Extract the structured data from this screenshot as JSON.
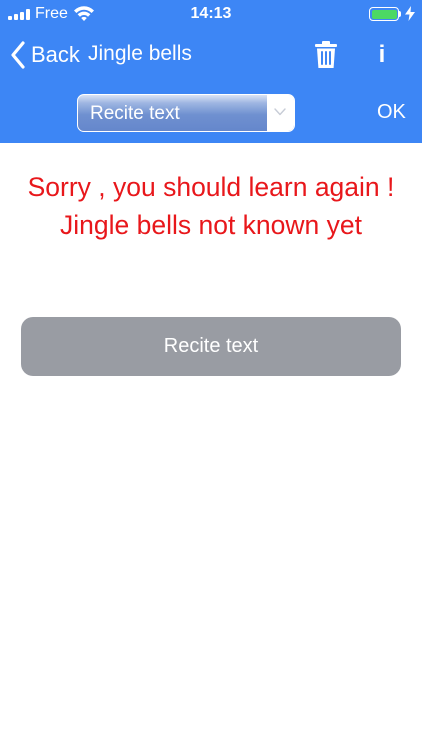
{
  "status_bar": {
    "carrier": "Free",
    "time": "14:13"
  },
  "nav": {
    "back_label": "Back",
    "title": "Jingle bells",
    "info_label": "i"
  },
  "toolbar": {
    "mode_select": {
      "selected": "Recite text"
    },
    "ok_label": "OK"
  },
  "main": {
    "message": "Sorry , you should learn again ! Jingle bells not known yet",
    "recite_button_label": "Recite text"
  },
  "colors": {
    "header_background": "#3d86f5",
    "message_text": "#e8171b",
    "button_background": "#999ca3",
    "battery_fill": "#4cd964"
  },
  "icons": {
    "signal": "signal-bars-icon",
    "wifi": "wifi-icon",
    "battery": "battery-icon",
    "charging": "charging-bolt-icon",
    "back": "chevron-left-icon",
    "trash": "trash-icon",
    "info": "info-icon",
    "dropdown": "chevron-down-icon"
  }
}
